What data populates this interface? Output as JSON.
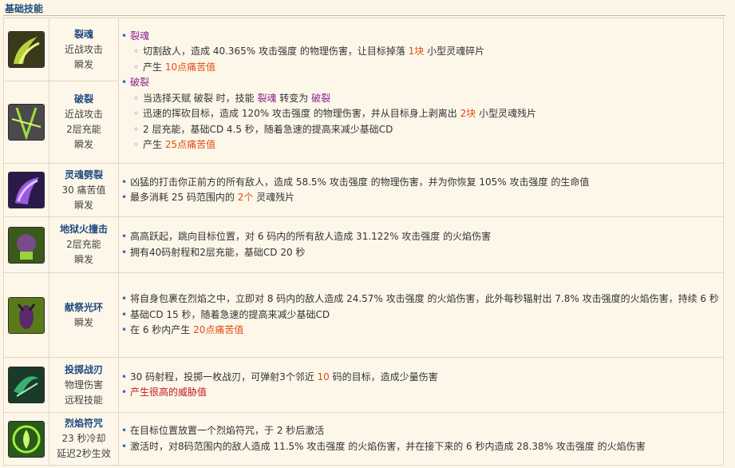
{
  "section_title": "基础技能",
  "colors": {
    "purple": "#8a1c8e",
    "orange": "#e24c12",
    "red": "#c0141c",
    "name": "#1f4a80"
  },
  "skills": [
    {
      "name": "裂魂",
      "sub1": "近战攻击",
      "sub2": "瞬发",
      "icon": "soul-cleave-icon"
    },
    {
      "name": "破裂",
      "sub1": "近战攻击",
      "sub2": "2层充能",
      "sub3": "瞬发",
      "icon": "fracture-icon"
    },
    {
      "name": "灵魂劈裂",
      "sub1": "30 痛苦值",
      "sub2": "瞬发",
      "icon": "soul-rend-icon",
      "desc": {
        "l1": "凶猛的打击你正前方的所有敌人，造成 58.5% 攻击强度 的物理伤害，并为你恢复 105% 攻击强度 的生命值",
        "l2a": "最多消耗 25 码范围内的 ",
        "l2b": "2个",
        "l2c": " 灵魂残片"
      }
    },
    {
      "name": "地狱火撞击",
      "sub1": "2层充能",
      "sub2": "瞬发",
      "icon": "infernal-strike-icon",
      "desc": {
        "l1": "高高跃起，跳向目标位置，对 6 码内的所有敌人造成 31.122% 攻击强度 的火焰伤害",
        "l2": "拥有40码射程和2层充能，基础CD 20 秒"
      }
    },
    {
      "name": "献祭光环",
      "sub1": "瞬发",
      "icon": "immolation-aura-icon",
      "desc": {
        "l1": "将自身包裹在烈焰之中，立即对 8 码内的敌人造成 24.57% 攻击强度 的火焰伤害，此外每秒辐射出 7.8% 攻击强度的火焰伤害，持续 6 秒",
        "l2": "基础CD 15 秒，随着急速的提高来减少基础CD",
        "l3a": "在 6 秒内产生 ",
        "l3b": "20点痛苦值"
      }
    },
    {
      "name": "投掷战刃",
      "sub1": "物理伤害",
      "sub2": "远程技能",
      "icon": "throw-glaive-icon",
      "desc": {
        "l1a": "30 码射程，投掷一枚战刃，可弹射3个邻近 ",
        "l1b": "10",
        "l1c": " 码的目标，造成少量伤害",
        "l2": "产生很高的威胁值"
      }
    },
    {
      "name": "烈焰符咒",
      "sub1": "23 秒冷却",
      "sub2": "延迟2秒生效",
      "icon": "sigil-of-flame-icon",
      "desc": {
        "l1": "在目标位置放置一个烈焰符咒，于 2 秒后激活",
        "l2": "激活时，对8码范围内的敌人造成 11.5% 攻击强度 的火焰伤害，并在接下来的 6 秒内造成 28.38% 攻击强度 的火焰伤害"
      }
    }
  ],
  "combined_desc": {
    "soul_cleave": {
      "title": "裂魂",
      "l1a": "切割敌人，造成 40.365% 攻击强度 的物理伤害，让目标掉落 ",
      "l1b": "1块",
      "l1c": " 小型灵魂碎片",
      "l2a": "产生 ",
      "l2b": "10点痛苦值"
    },
    "fracture": {
      "title": "破裂",
      "l1a": "当选择天赋 破裂 时，技能 ",
      "l1b": "裂魂",
      "l1c": " 转变为 ",
      "l1d": "破裂",
      "l2a": "迅速的挥砍目标，造成 120% 攻击强度 的物理伤害，并从目标身上剥离出 ",
      "l2b": "2块",
      "l2c": " 小型灵魂残片",
      "l3": "2 层充能，基础CD 4.5 秒，随着急速的提高来减少基础CD",
      "l4a": "产生 ",
      "l4b": "25点痛苦值"
    }
  }
}
